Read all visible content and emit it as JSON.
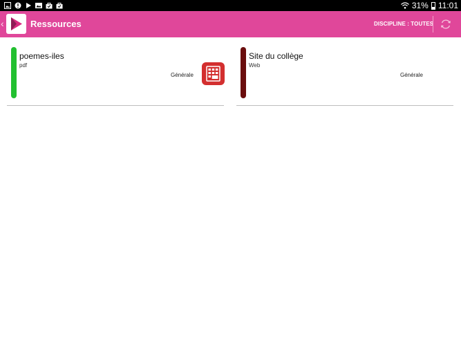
{
  "status_bar": {
    "battery": "31%",
    "time": "11:01",
    "battery_level": 0.31,
    "left_icons": [
      "gallery-icon",
      "notification-icon",
      "play-store-icon",
      "image-icon",
      "bag-icon",
      "bag-icon"
    ]
  },
  "app_bar": {
    "back_glyph": "‹",
    "title": "Ressources",
    "discipline_filter": "DISCIPLINE : TOUTES",
    "color": "#e0479a"
  },
  "resources": [
    {
      "title": "poemes-iles",
      "type": "pdf",
      "category": "Générale",
      "accent": "#22c030",
      "has_pdf_icon": true
    },
    {
      "title": "Site du collège",
      "type": "Web",
      "category": "Générale",
      "accent": "#6b0e0e",
      "has_pdf_icon": false
    }
  ]
}
